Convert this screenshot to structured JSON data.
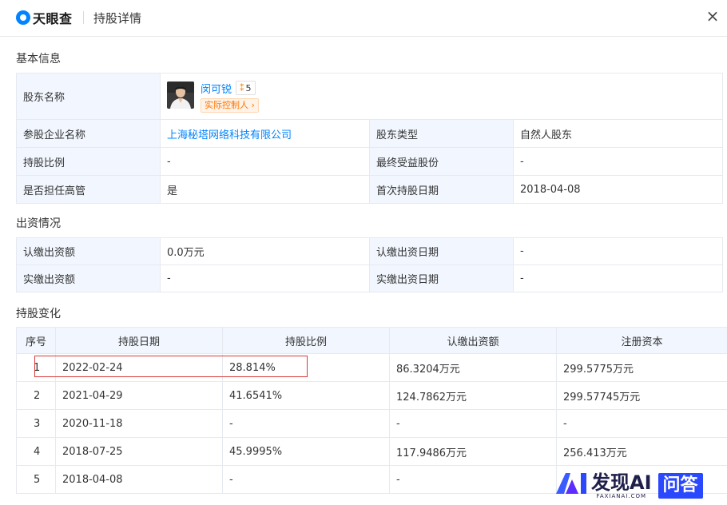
{
  "header": {
    "logo_text": "天眼查",
    "title": "持股详情",
    "close_label": "×"
  },
  "basic": {
    "section_title": "基本信息",
    "shareholder_label": "股东名称",
    "shareholder_name": "闵可锐",
    "relation_count": "5",
    "controller_tag": "实际控制人",
    "company_label": "参股企业名称",
    "company_name": "上海秘塔网络科技有限公司",
    "type_label": "股东类型",
    "type_value": "自然人股东",
    "ratio_label": "持股比例",
    "ratio_value": "-",
    "final_label": "最终受益股份",
    "final_value": "-",
    "exec_label": "是否担任高管",
    "exec_value": "是",
    "first_date_label": "首次持股日期",
    "first_date_value": "2018-04-08"
  },
  "investment": {
    "section_title": "出资情况",
    "sub_amount_label": "认缴出资额",
    "sub_amount_value": "0.0万元",
    "sub_date_label": "认缴出资日期",
    "sub_date_value": "-",
    "paid_amount_label": "实缴出资额",
    "paid_amount_value": "-",
    "paid_date_label": "实缴出资日期",
    "paid_date_value": "-"
  },
  "history": {
    "section_title": "持股变化",
    "columns": [
      "序号",
      "持股日期",
      "持股比例",
      "认缴出资额",
      "注册资本"
    ],
    "rows": [
      [
        "1",
        "2022-02-24",
        "28.814%",
        "86.3204万元",
        "299.5775万元"
      ],
      [
        "2",
        "2021-04-29",
        "41.6541%",
        "124.7862万元",
        "299.57745万元"
      ],
      [
        "3",
        "2020-11-18",
        "-",
        "-",
        "-"
      ],
      [
        "4",
        "2018-07-25",
        "45.9995%",
        "117.9486万元",
        "256.413万元"
      ],
      [
        "5",
        "2018-04-08",
        "-",
        "-",
        ""
      ]
    ]
  },
  "watermark": {
    "brand": "发现AI",
    "sub": "FAXIANAI.COM",
    "qa": "问答"
  }
}
